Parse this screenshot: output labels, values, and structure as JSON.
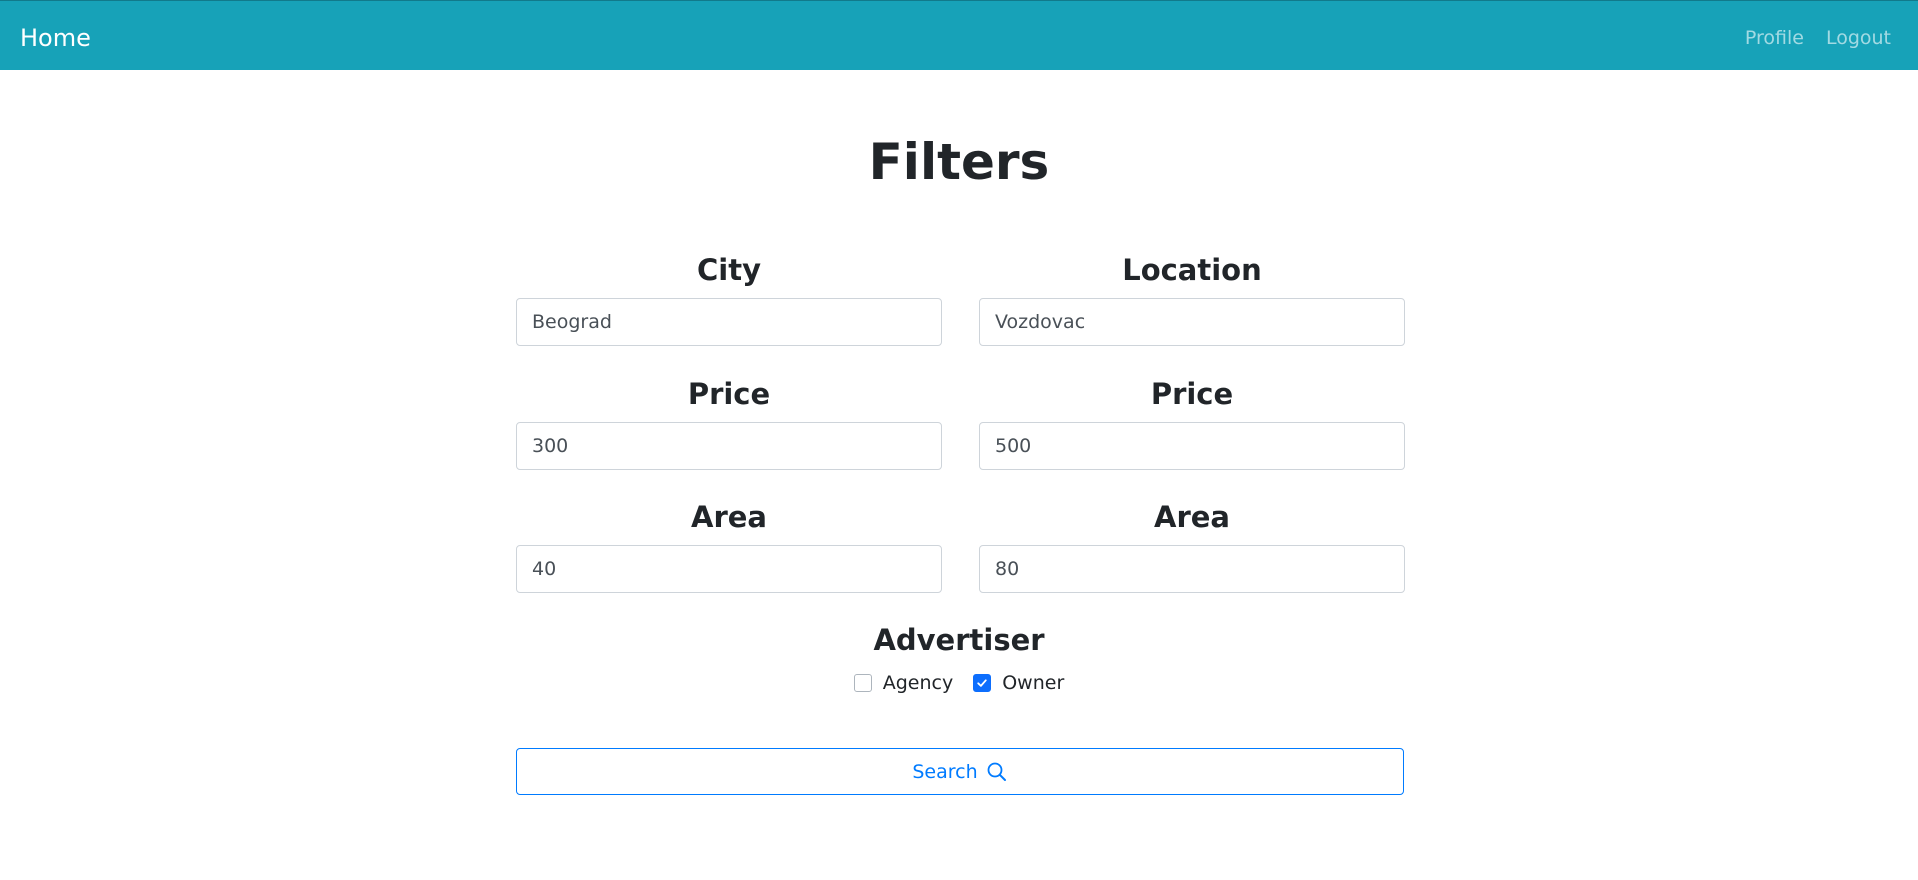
{
  "navbar": {
    "brand": "Home",
    "links": [
      "Profile",
      "Logout"
    ],
    "background": "#17a2b8"
  },
  "page": {
    "title": "Filters"
  },
  "filters": {
    "city": {
      "label": "City",
      "value": "Beograd"
    },
    "location": {
      "label": "Location",
      "value": "Vozdovac"
    },
    "price_min": {
      "label": "Price",
      "value": "300"
    },
    "price_max": {
      "label": "Price",
      "value": "500"
    },
    "area_min": {
      "label": "Area",
      "value": "40"
    },
    "area_max": {
      "label": "Area",
      "value": "80"
    }
  },
  "advertiser": {
    "label": "Advertiser",
    "options": [
      {
        "label": "Agency",
        "checked": false
      },
      {
        "label": "Owner",
        "checked": true
      }
    ]
  },
  "search_button": {
    "label": "Search",
    "icon": "search-icon",
    "color": "#007bff"
  }
}
